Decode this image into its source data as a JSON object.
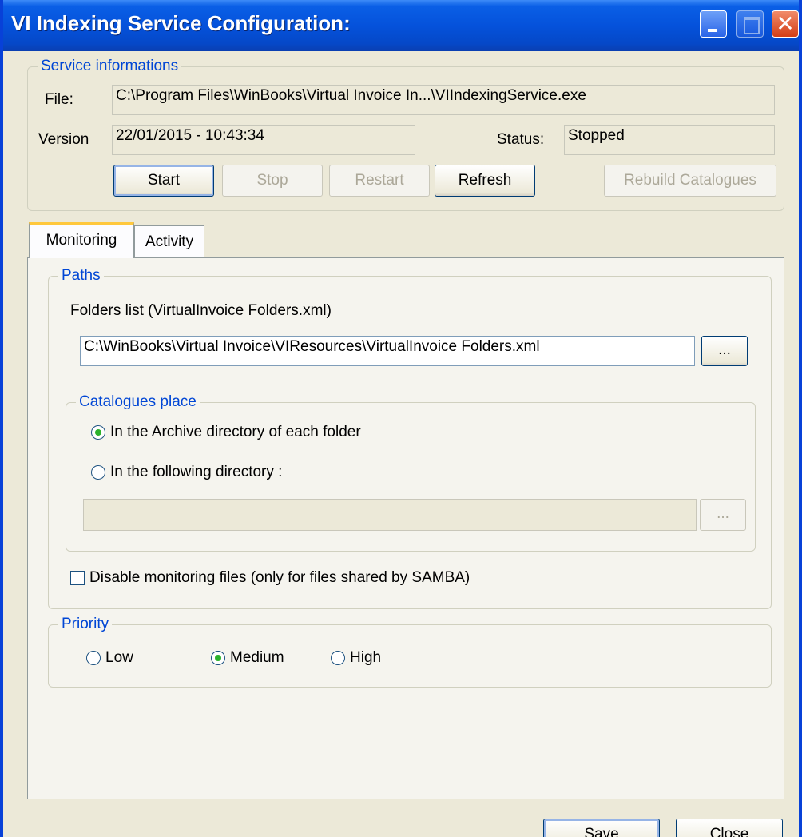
{
  "window": {
    "title": "VI Indexing Service Configuration:"
  },
  "service_info": {
    "legend": "Service informations",
    "file_label": "File:",
    "file_value": "C:\\Program Files\\WinBooks\\Virtual Invoice In...\\VIIndexingService.exe",
    "version_label": "Version",
    "version_value": "22/01/2015 - 10:43:34",
    "status_label": "Status:",
    "status_value": "Stopped",
    "buttons": {
      "start": "Start",
      "stop": "Stop",
      "restart": "Restart",
      "refresh": "Refresh",
      "rebuild": "Rebuild Catalogues"
    }
  },
  "tabs": {
    "monitoring": "Monitoring",
    "activity": "Activity"
  },
  "paths": {
    "legend": "Paths",
    "folders_label": "Folders list (VirtualInvoice Folders.xml)",
    "folders_value": "C:\\WinBooks\\Virtual Invoice\\VIResources\\VirtualInvoice Folders.xml",
    "browse_label": "...",
    "catalogues": {
      "legend": "Catalogues place",
      "option_archive": "In the Archive directory of each folder",
      "option_following": "In the following directory :",
      "directory_value": "",
      "browse_label": "...",
      "selected": "archive"
    },
    "disable_monitoring_label": "Disable monitoring files (only for files shared by SAMBA)",
    "disable_monitoring_checked": false
  },
  "priority": {
    "legend": "Priority",
    "low": "Low",
    "medium": "Medium",
    "high": "High",
    "selected": "medium"
  },
  "footer": {
    "save": "Save",
    "close": "Close"
  }
}
